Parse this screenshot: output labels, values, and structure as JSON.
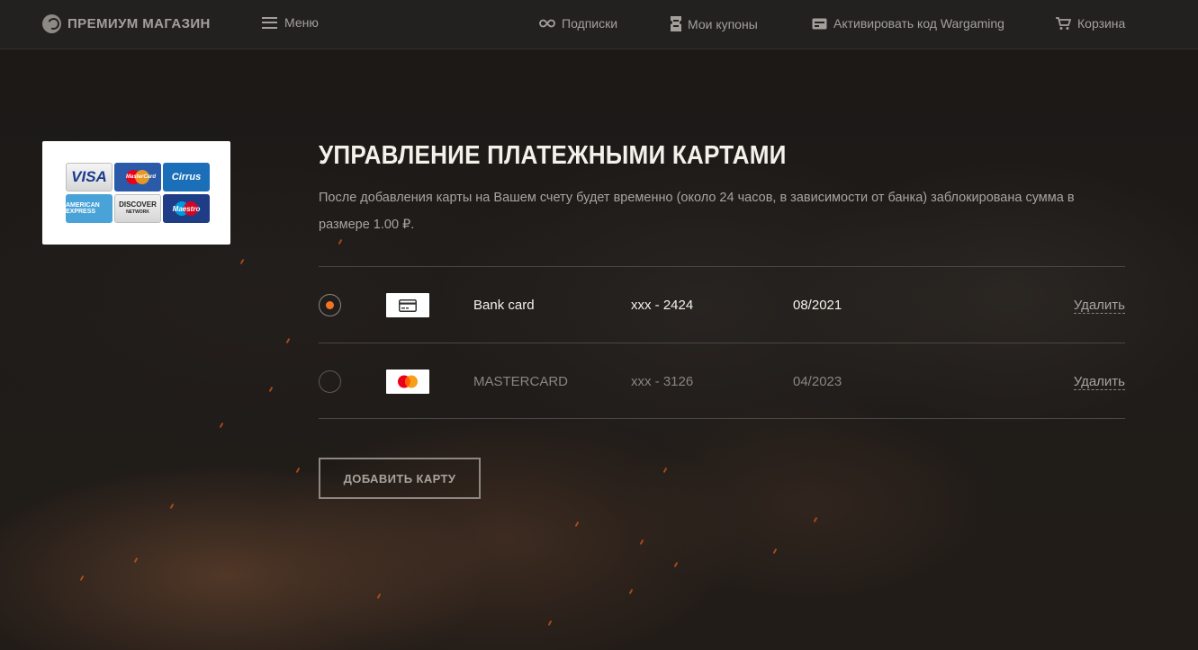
{
  "header": {
    "brand": "ПРЕМИУМ МАГАЗИН",
    "menu_label": "Меню",
    "nav": {
      "subscriptions": "Подписки",
      "coupons": "Мои купоны",
      "activate": "Активировать код Wargaming",
      "cart": "Корзина"
    }
  },
  "payment_logos": {
    "visa": "VISA",
    "mastercard": "MasterCard",
    "cirrus": "Cirrus",
    "amex": "AMERICAN EXPRESS",
    "discover": "DISCOVER",
    "discover_sub": "NETWORK",
    "maestro": "Maestro"
  },
  "main": {
    "title": "УПРАВЛЕНИЕ ПЛАТЕЖНЫМИ КАРТАМИ",
    "description": "После добавления карты на Вашем счету будет временно (около 24 часов, в зависимости от банка) заблокирована сумма в размере 1.00 ₽.",
    "cards": [
      {
        "name": "Bank card",
        "number": "xxx - 2424",
        "expiry": "08/2021",
        "delete_label": "Удалить",
        "selected": true,
        "icon": "bank-card-icon"
      },
      {
        "name": "MASTERCARD",
        "number": "xxx - 3126",
        "expiry": "04/2023",
        "delete_label": "Удалить",
        "selected": false,
        "icon": "mastercard-icon"
      }
    ],
    "add_button": "ДОБАВИТЬ КАРТУ"
  },
  "colors": {
    "accent": "#f07426",
    "header_bg": "#232120",
    "page_bg": "#1c1917"
  }
}
